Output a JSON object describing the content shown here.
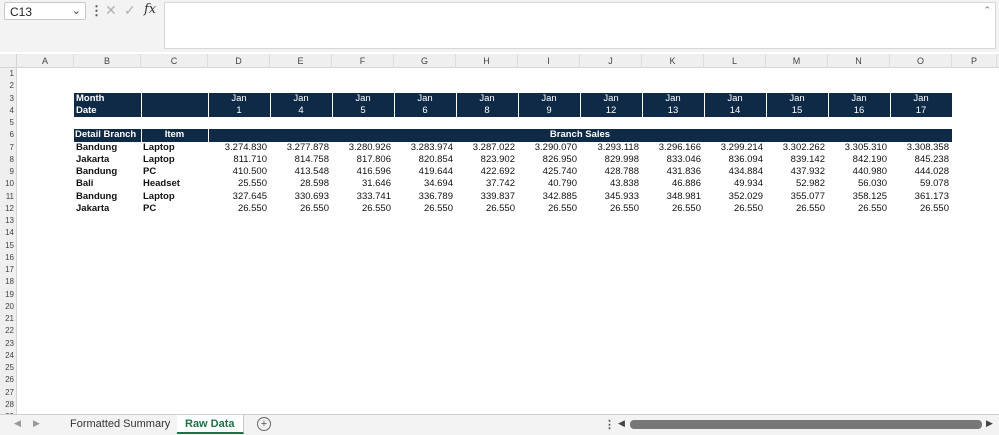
{
  "formula_bar": {
    "name_box": "C13",
    "caret": "⌄",
    "menu": "⋮",
    "cancel": "✕",
    "enter": "✓",
    "fx": "fx",
    "expand": "⌃",
    "formula": ""
  },
  "columns": [
    "A",
    "B",
    "C",
    "D",
    "E",
    "F",
    "G",
    "H",
    "I",
    "J",
    "K",
    "L",
    "M",
    "N",
    "O",
    "P"
  ],
  "rows": [
    "1",
    "2",
    "3",
    "4",
    "5",
    "6",
    "7",
    "8",
    "9",
    "10",
    "11",
    "12",
    "13",
    "14",
    "15",
    "16",
    "17",
    "18",
    "19",
    "20",
    "21",
    "22",
    "23",
    "24",
    "25",
    "26",
    "27",
    "28",
    "29"
  ],
  "header_table": {
    "month_label": "Month",
    "date_label": "Date",
    "months": [
      "Jan",
      "Jan",
      "Jan",
      "Jan",
      "Jan",
      "Jan",
      "Jan",
      "Jan",
      "Jan",
      "Jan",
      "Jan",
      "Jan"
    ],
    "dates": [
      "1",
      "4",
      "5",
      "6",
      "8",
      "9",
      "12",
      "13",
      "14",
      "15",
      "16",
      "17"
    ]
  },
  "data_table": {
    "col_branch": "Detail Branch",
    "col_item": "Item",
    "col_sales": "Branch Sales",
    "rows": [
      {
        "branch": "Bandung",
        "item": "Laptop",
        "values": [
          "3.274.830",
          "3.277.878",
          "3.280.926",
          "3.283.974",
          "3.287.022",
          "3.290.070",
          "3.293.118",
          "3.296.166",
          "3.299.214",
          "3.302.262",
          "3.305.310",
          "3.308.358"
        ]
      },
      {
        "branch": "Jakarta",
        "item": "Laptop",
        "values": [
          "811.710",
          "814.758",
          "817.806",
          "820.854",
          "823.902",
          "826.950",
          "829.998",
          "833.046",
          "836.094",
          "839.142",
          "842.190",
          "845.238"
        ]
      },
      {
        "branch": "Bandung",
        "item": "PC",
        "values": [
          "410.500",
          "413.548",
          "416.596",
          "419.644",
          "422.692",
          "425.740",
          "428.788",
          "431.836",
          "434.884",
          "437.932",
          "440.980",
          "444.028"
        ]
      },
      {
        "branch": "Bali",
        "item": "Headset",
        "values": [
          "25.550",
          "28.598",
          "31.646",
          "34.694",
          "37.742",
          "40.790",
          "43.838",
          "46.886",
          "49.934",
          "52.982",
          "56.030",
          "59.078"
        ]
      },
      {
        "branch": "Bandung",
        "item": "Laptop",
        "values": [
          "327.645",
          "330.693",
          "333.741",
          "336.789",
          "339.837",
          "342.885",
          "345.933",
          "348.981",
          "352.029",
          "355.077",
          "358.125",
          "361.173"
        ]
      },
      {
        "branch": "Jakarta",
        "item": "PC",
        "values": [
          "26.550",
          "26.550",
          "26.550",
          "26.550",
          "26.550",
          "26.550",
          "26.550",
          "26.550",
          "26.550",
          "26.550",
          "26.550",
          "26.550"
        ]
      }
    ]
  },
  "sheet_tabs": {
    "prev": "◀",
    "next": "▶",
    "tabs": [
      "Formatted Summary",
      "Raw Data"
    ],
    "active": "Raw Data",
    "add": "+"
  },
  "scroll": {
    "dots": "⋮",
    "left": "◀",
    "right": "▶"
  },
  "colors": {
    "header_band": "#0e2a47",
    "active_tab": "#1e7145"
  }
}
